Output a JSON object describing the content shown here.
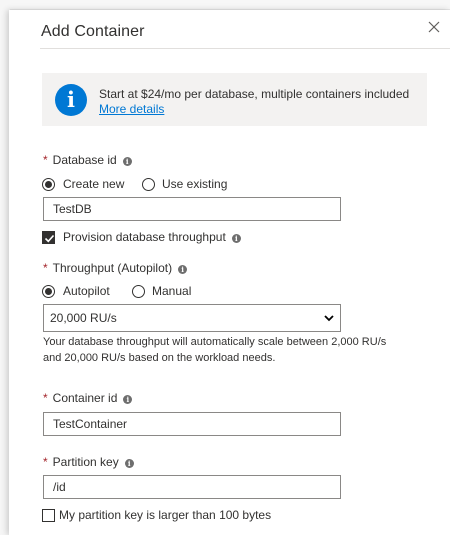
{
  "panel": {
    "title": "Add Container",
    "info": {
      "text": "Start at $24/mo per database, multiple containers included",
      "link": "More details"
    }
  },
  "database_id": {
    "label": "Database id",
    "options": [
      "Create new",
      "Use existing"
    ],
    "selected": "Create new",
    "value": "TestDB",
    "provision_label": "Provision database throughput",
    "provision_checked": true
  },
  "throughput": {
    "label": "Throughput (Autopilot)",
    "options": [
      "Autopilot",
      "Manual"
    ],
    "selected": "Autopilot",
    "select_value": "20,000 RU/s",
    "help_line1": "Your database throughput will automatically scale between 2,000 RU/s",
    "help_line2": "and 20,000 RU/s based on the workload needs."
  },
  "container_id": {
    "label": "Container id",
    "value": "TestContainer"
  },
  "partition_key": {
    "label": "Partition key",
    "value": "/id",
    "large_key_label": "My partition key is larger than 100 bytes",
    "large_key_checked": false
  },
  "icons": {
    "close": "close-icon",
    "info": "info-icon",
    "tooltip": "info-tooltip-icon",
    "dropdown": "chevron-down-icon"
  },
  "colors": {
    "accent": "#0078d4",
    "required": "#a4262c",
    "info_bg": "#f3f2f1"
  }
}
